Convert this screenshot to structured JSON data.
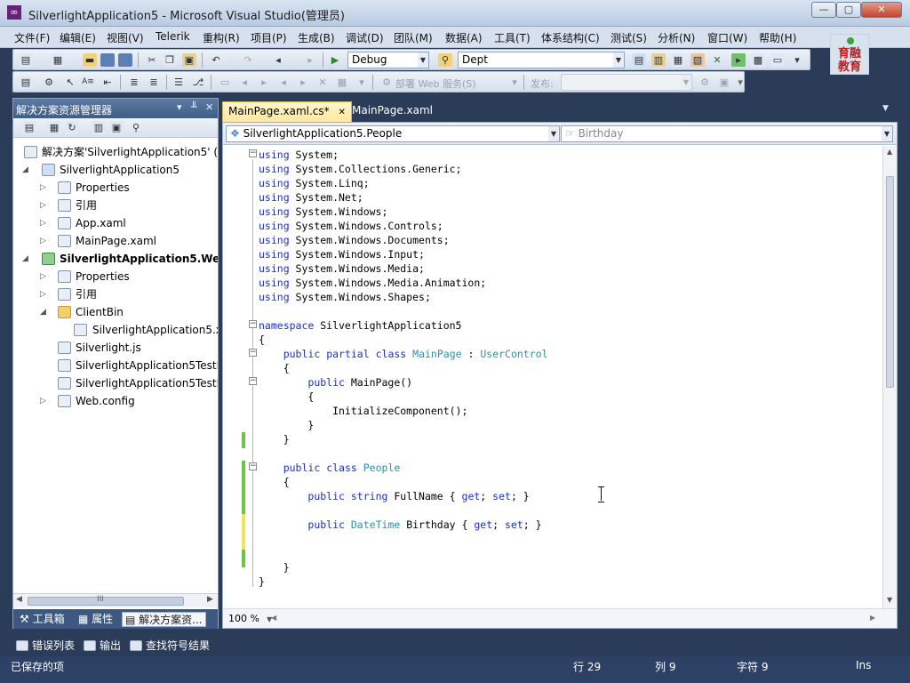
{
  "window": {
    "title": "SilverlightApplication5 - Microsoft Visual Studio(管理员)",
    "buttons": {
      "minimize": "—",
      "maximize": "▢",
      "close": "✕"
    }
  },
  "menu": [
    "文件(F)",
    "编辑(E)",
    "视图(V)",
    "Telerik",
    "重构(R)",
    "项目(P)",
    "生成(B)",
    "调试(D)",
    "团队(M)",
    "数据(A)",
    "工具(T)",
    "体系结构(C)",
    "测试(S)",
    "分析(N)",
    "窗口(W)",
    "帮助(H)"
  ],
  "toolbar": {
    "configuration": "Debug",
    "platform": "Dept",
    "disabled_label_1": "部署 Web 服务(S)",
    "disabled_label_2": "发布:"
  },
  "logo": {
    "text": "育融\n教育"
  },
  "solution_explorer": {
    "title": "解决方案资源管理器",
    "pin_icon": "▾ ╨",
    "close_icon": "✕",
    "tree": [
      {
        "label": "解决方案'SilverlightApplication5' (2",
        "toggle": "",
        "icon": "solution",
        "bold": false
      },
      {
        "label": "SilverlightApplication5",
        "toggle": "◢",
        "icon": "project",
        "bold": false
      },
      {
        "label": "Properties",
        "toggle": "▷",
        "icon": "properties",
        "bold": false
      },
      {
        "label": "引用",
        "toggle": "▷",
        "icon": "references",
        "bold": false
      },
      {
        "label": "App.xaml",
        "toggle": "▷",
        "icon": "xaml-file",
        "bold": false
      },
      {
        "label": "MainPage.xaml",
        "toggle": "▷",
        "icon": "xaml-file",
        "bold": false
      },
      {
        "label": "SilverlightApplication5.Web",
        "toggle": "◢",
        "icon": "web-project",
        "bold": true
      },
      {
        "label": "Properties",
        "toggle": "▷",
        "icon": "properties",
        "bold": false
      },
      {
        "label": "引用",
        "toggle": "▷",
        "icon": "references",
        "bold": false
      },
      {
        "label": "ClientBin",
        "toggle": "◢",
        "icon": "folder",
        "bold": false
      },
      {
        "label": "SilverlightApplication5.xa",
        "toggle": "",
        "icon": "xap-file",
        "bold": false
      },
      {
        "label": "Silverlight.js",
        "toggle": "",
        "icon": "js-file",
        "bold": false
      },
      {
        "label": "SilverlightApplication5TestP",
        "toggle": "",
        "icon": "html-file",
        "bold": false
      },
      {
        "label": "SilverlightApplication5TestP",
        "toggle": "",
        "icon": "aspx-file",
        "bold": false
      },
      {
        "label": "Web.config",
        "toggle": "▷",
        "icon": "config-file",
        "bold": false
      }
    ],
    "hscroll_thumb_label": "III",
    "tabs": [
      "工具箱",
      "属性",
      "解决方案资..."
    ]
  },
  "editor": {
    "tabs": [
      {
        "label": "MainPage.xaml.cs*",
        "close": "✕",
        "active": true
      },
      {
        "label": "MainPage.xaml",
        "close": "",
        "active": false
      }
    ],
    "type_nav": "SilverlightApplication5.People",
    "member_nav": "Birthday",
    "zoom": "100 %",
    "code_lines": [
      [
        {
          "t": "using",
          "c": "kw"
        },
        {
          "t": " System;",
          "c": ""
        }
      ],
      [
        {
          "t": "using",
          "c": "kw"
        },
        {
          "t": " System.Collections.Generic;",
          "c": ""
        }
      ],
      [
        {
          "t": "using",
          "c": "kw"
        },
        {
          "t": " System.Linq;",
          "c": ""
        }
      ],
      [
        {
          "t": "using",
          "c": "kw"
        },
        {
          "t": " System.Net;",
          "c": ""
        }
      ],
      [
        {
          "t": "using",
          "c": "kw"
        },
        {
          "t": " System.Windows;",
          "c": ""
        }
      ],
      [
        {
          "t": "using",
          "c": "kw"
        },
        {
          "t": " System.Windows.Controls;",
          "c": ""
        }
      ],
      [
        {
          "t": "using",
          "c": "kw"
        },
        {
          "t": " System.Windows.Documents;",
          "c": ""
        }
      ],
      [
        {
          "t": "using",
          "c": "kw"
        },
        {
          "t": " System.Windows.Input;",
          "c": ""
        }
      ],
      [
        {
          "t": "using",
          "c": "kw"
        },
        {
          "t": " System.Windows.Media;",
          "c": ""
        }
      ],
      [
        {
          "t": "using",
          "c": "kw"
        },
        {
          "t": " System.Windows.Media.Animation;",
          "c": ""
        }
      ],
      [
        {
          "t": "using",
          "c": "kw"
        },
        {
          "t": " System.Windows.Shapes;",
          "c": ""
        }
      ],
      [],
      [
        {
          "t": "namespace",
          "c": "kw"
        },
        {
          "t": " SilverlightApplication5",
          "c": ""
        }
      ],
      [
        {
          "t": "{",
          "c": ""
        }
      ],
      [
        {
          "t": "    ",
          "c": ""
        },
        {
          "t": "public",
          "c": "kw"
        },
        {
          "t": " ",
          "c": ""
        },
        {
          "t": "partial",
          "c": "kw"
        },
        {
          "t": " ",
          "c": ""
        },
        {
          "t": "class",
          "c": "kw"
        },
        {
          "t": " ",
          "c": ""
        },
        {
          "t": "MainPage",
          "c": "ty"
        },
        {
          "t": " : ",
          "c": ""
        },
        {
          "t": "UserControl",
          "c": "ty"
        }
      ],
      [
        {
          "t": "    {",
          "c": ""
        }
      ],
      [
        {
          "t": "        ",
          "c": ""
        },
        {
          "t": "public",
          "c": "kw"
        },
        {
          "t": " MainPage()",
          "c": ""
        }
      ],
      [
        {
          "t": "        {",
          "c": ""
        }
      ],
      [
        {
          "t": "            InitializeComponent();",
          "c": ""
        }
      ],
      [
        {
          "t": "        }",
          "c": ""
        }
      ],
      [
        {
          "t": "    }",
          "c": ""
        }
      ],
      [],
      [
        {
          "t": "    ",
          "c": ""
        },
        {
          "t": "public",
          "c": "kw"
        },
        {
          "t": " ",
          "c": ""
        },
        {
          "t": "class",
          "c": "kw"
        },
        {
          "t": " ",
          "c": ""
        },
        {
          "t": "People",
          "c": "ty"
        }
      ],
      [
        {
          "t": "    {",
          "c": ""
        }
      ],
      [
        {
          "t": "        ",
          "c": ""
        },
        {
          "t": "public",
          "c": "kw"
        },
        {
          "t": " ",
          "c": ""
        },
        {
          "t": "string",
          "c": "kw"
        },
        {
          "t": " FullName { ",
          "c": ""
        },
        {
          "t": "get",
          "c": "kw"
        },
        {
          "t": "; ",
          "c": ""
        },
        {
          "t": "set",
          "c": "kw"
        },
        {
          "t": "; }",
          "c": ""
        }
      ],
      [],
      [
        {
          "t": "        ",
          "c": ""
        },
        {
          "t": "public",
          "c": "kw"
        },
        {
          "t": " ",
          "c": ""
        },
        {
          "t": "DateTime",
          "c": "ty"
        },
        {
          "t": " Birthday { ",
          "c": ""
        },
        {
          "t": "get",
          "c": "kw"
        },
        {
          "t": "; ",
          "c": ""
        },
        {
          "t": "set",
          "c": "kw"
        },
        {
          "t": "; }",
          "c": ""
        }
      ],
      [],
      [],
      [
        {
          "t": "    }",
          "c": ""
        }
      ],
      [
        {
          "t": "}",
          "c": ""
        }
      ]
    ]
  },
  "bottom_tabs": [
    "错误列表",
    "输出",
    "查找符号结果"
  ],
  "status": {
    "message": "已保存的项",
    "line": "行 29",
    "column": "列 9",
    "char": "字符 9",
    "mode": "Ins"
  },
  "colors": {
    "keyword": "#1b30c6",
    "type": "#2b91af",
    "change_saved": "#6cc644",
    "change_unsaved": "#f2e45c"
  }
}
